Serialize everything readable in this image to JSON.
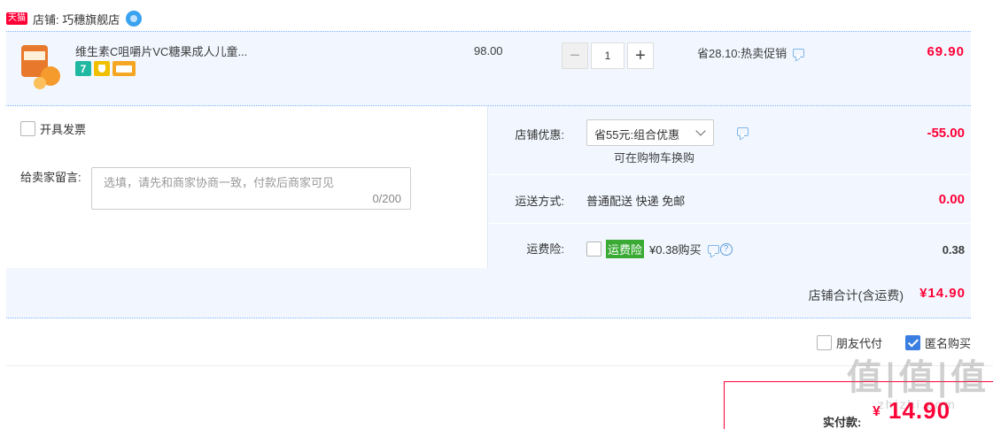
{
  "shop": {
    "badge": "天猫",
    "name": "店铺: 巧穗旗舰店"
  },
  "item": {
    "title": "维生素C咀嚼片VC糖果成人儿童...",
    "tag_seven": "7",
    "unit_price": "98.00",
    "quantity": "1",
    "promo": "省28.10:热卖促销",
    "total": "69.90"
  },
  "options": {
    "invoice_label": "开具发票",
    "message_label": "给卖家留言:",
    "message_placeholder": "选填，请先和商家协商一致，付款后商家可见",
    "message_count": "0/200",
    "store_discount_label": "店铺优惠:",
    "store_discount_selected": "省55元:组合优惠",
    "store_discount_hint": "可在购物车换购",
    "store_discount_value": "-55.00",
    "shipping_label": "运送方式:",
    "shipping_method": "普通配送 快递 免邮",
    "shipping_value": "0.00",
    "insurance_label": "运费险:",
    "insurance_tag": "运费险",
    "insurance_price": "¥0.38购买",
    "insurance_help": "?",
    "insurance_value": "0.38"
  },
  "shop_total": {
    "label": "店铺合计(含运费)",
    "value": "¥14.90"
  },
  "pay_options": {
    "friend_pay": "朋友代付",
    "anonymous": "匿名购买",
    "anonymous_checked": true
  },
  "final": {
    "label": "实付款:",
    "currency": "¥",
    "value": "14.90"
  },
  "watermark": {
    "big": "值|值|值",
    "small": "zhizhi.com"
  },
  "colors": {
    "accent": "#ff0036",
    "row_bg": "#f2f7ff",
    "checkbox_blue": "#3b7ee1",
    "insurance_green": "#3aaa35"
  },
  "icons": [
    "tmall-badge",
    "wangwang-icon",
    "chat-icon",
    "minus-icon",
    "plus-icon",
    "chevron-down-icon",
    "help-icon",
    "checkmark-icon"
  ]
}
